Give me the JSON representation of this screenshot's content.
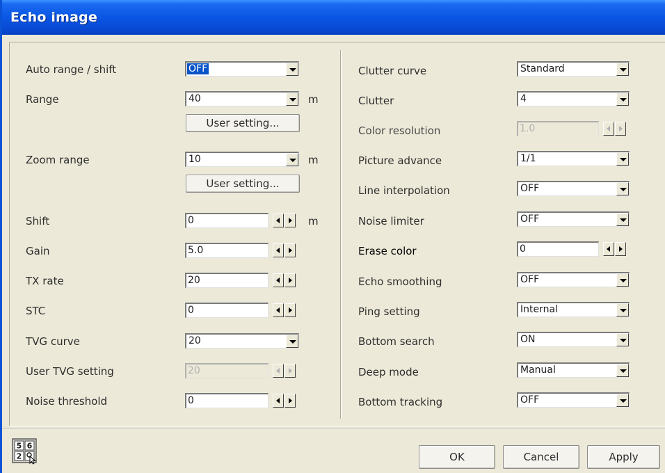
{
  "window": {
    "title": "Echo image"
  },
  "left": {
    "auto_range_shift": {
      "label": "Auto range / shift",
      "value": "OFF"
    },
    "range": {
      "label": "Range",
      "value": "40",
      "unit": "m",
      "user_setting": "User setting..."
    },
    "zoom_range": {
      "label": "Zoom range",
      "value": "10",
      "unit": "m",
      "user_setting": "User setting..."
    },
    "shift": {
      "label": "Shift",
      "value": "0",
      "unit": "m"
    },
    "gain": {
      "label": "Gain",
      "value": "5.0"
    },
    "tx_rate": {
      "label": "TX rate",
      "value": "20"
    },
    "stc": {
      "label": "STC",
      "value": "0"
    },
    "tvg_curve": {
      "label": "TVG curve",
      "value": "20"
    },
    "user_tvg": {
      "label": "User TVG setting",
      "value": "20"
    },
    "noise_threshold": {
      "label": "Noise threshold",
      "value": "0"
    }
  },
  "right": {
    "clutter_curve": {
      "label": "Clutter curve",
      "value": "Standard"
    },
    "clutter": {
      "label": "Clutter",
      "value": "4"
    },
    "color_resolution": {
      "label": "Color resolution",
      "value": "1.0"
    },
    "picture_advance": {
      "label": "Picture advance",
      "value": "1/1"
    },
    "line_interpolation": {
      "label": "Line interpolation",
      "value": "OFF"
    },
    "noise_limiter": {
      "label": "Noise limiter",
      "value": "OFF"
    },
    "erase_color": {
      "label": "Erase color",
      "value": "0"
    },
    "echo_smoothing": {
      "label": "Echo smoothing",
      "value": "OFF"
    },
    "ping_setting": {
      "label": "Ping setting",
      "value": "Internal"
    },
    "bottom_search": {
      "label": "Bottom search",
      "value": "ON"
    },
    "deep_mode": {
      "label": "Deep mode",
      "value": "Manual"
    },
    "bottom_tracking": {
      "label": "Bottom tracking",
      "value": "OFF"
    }
  },
  "footer": {
    "ok": "OK",
    "cancel": "Cancel",
    "apply": "Apply",
    "keypad_icon": "numeric-keypad-icon",
    "keypad_digits": [
      "5",
      "6",
      "2"
    ]
  },
  "colors": {
    "titlebar": "#0a56e4",
    "dialog_bg": "#ece9d8",
    "selection": "#0a54c8"
  }
}
